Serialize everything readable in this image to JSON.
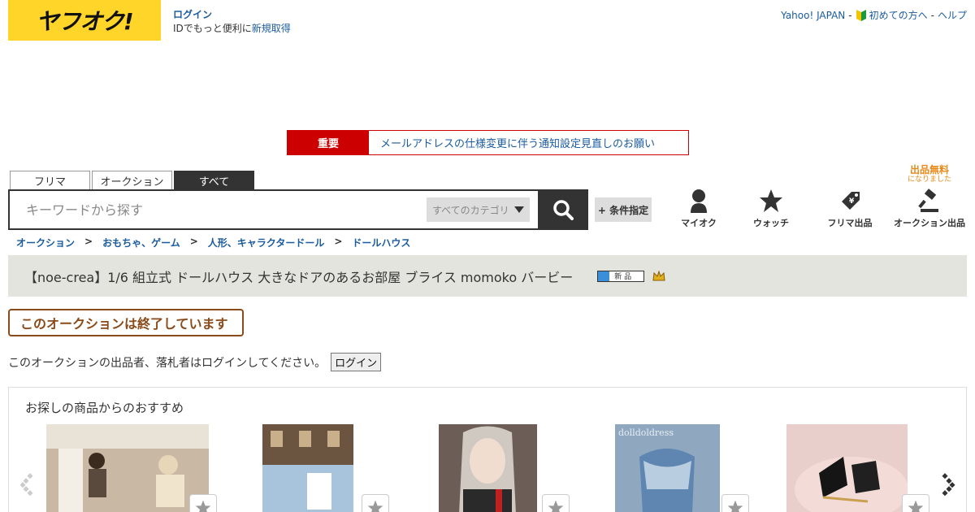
{
  "header": {
    "logo_text": "ヤフオク!",
    "login_label": "ログイン",
    "signup_prefix": "IDでもっと便利に",
    "signup_link": "新規取得",
    "yahoo_japan": "Yahoo! JAPAN",
    "beginner": "初めての方へ",
    "help": "ヘルプ",
    "sep": "-"
  },
  "notice": {
    "label": "重要",
    "text": "メールアドレスの仕様変更に伴う通知設定見直しのお願い"
  },
  "tabs": [
    {
      "label": "フリマ"
    },
    {
      "label": "オークション"
    },
    {
      "label": "すべて"
    }
  ],
  "search": {
    "placeholder": "キーワードから探す",
    "category": "すべてのカテゴリ",
    "conditions": "+ 条件指定"
  },
  "nav": {
    "myauction": "マイオク",
    "watch": "ウォッチ",
    "flea_listing": "フリマ出品",
    "auction_listing": "オークション出品",
    "free_badge_main": "出品無料",
    "free_badge_sub": "になりました"
  },
  "breadcrumb": {
    "items": [
      "オークション",
      "おもちゃ、ゲーム",
      "人形、キャラクタードール",
      "ドールハウス"
    ],
    "separator": ">"
  },
  "item": {
    "title": "【noe-crea】1/6 組立式 ドールハウス 大きなドアのあるお部屋 ブライス momoko バービー",
    "new_badge": "新 品"
  },
  "status": {
    "ended": "このオークションは終了しています",
    "login_note": "このオークションの出品者、落札者はログインしてください。",
    "login_button": "ログイン"
  },
  "recommend": {
    "title": "お探しの商品からのおすすめ",
    "items": [
      {
        "name": "rec-item-1",
        "color": "#c9b9a4"
      },
      {
        "name": "rec-item-2",
        "color": "#8a9fb5"
      },
      {
        "name": "rec-item-3",
        "color": "#6c5e56"
      },
      {
        "name": "rec-item-4",
        "color": "#8fa8c0"
      },
      {
        "name": "rec-item-5",
        "color": "#d8b8b2"
      }
    ],
    "watermark": "dolldoldress"
  },
  "colors": {
    "brand_yellow": "#ffd52a",
    "link_blue": "#1a5b9e",
    "alert_red": "#cc0000",
    "ended_brown": "#8a4a1a",
    "free_orange": "#e88a1a"
  }
}
